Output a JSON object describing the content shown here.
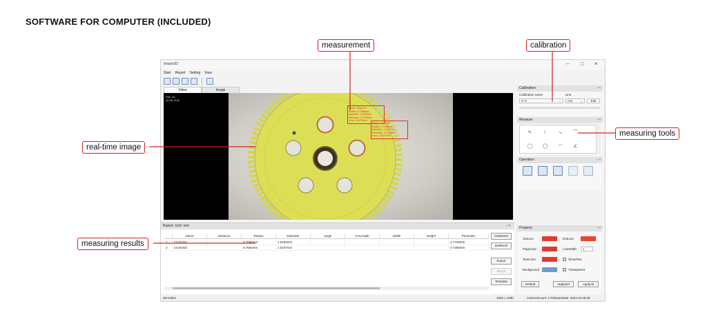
{
  "heading": "SOFTWARE FOR COMPUTER (INCLUDED)",
  "app": {
    "title": "Imsize2D",
    "window_controls": [
      "–",
      "□",
      "×"
    ],
    "menu": [
      "Start",
      "Report",
      "Setting",
      "View"
    ],
    "view_tabs": [
      "Video",
      "Image"
    ],
    "video_overlay": [
      "Fps: 14",
      "10:35, 6:41"
    ],
    "measurement_labels": [
      [
        "Name: Circle201",
        "Radius: 0.7596mm",
        "Diameter: 1.5192mm",
        "Perimeter: 4.7728mm",
        "Area: 1.8127mm²"
      ],
      [
        "Name: Circle202",
        "Radius: 0.7554mm",
        "Diameter: 1.5107mm",
        "Perimeter: 4.7460mm",
        "Area: 1.7927mm²"
      ]
    ]
  },
  "calibration": {
    "title": "Calibration",
    "name_label": "Calibration name",
    "unit_label": "Unit",
    "name_value": "0.7x",
    "unit_value": "mm",
    "edit_label": "Edit"
  },
  "measure_panel": {
    "title": "Measure"
  },
  "operation_panel": {
    "title": "Operation"
  },
  "report": {
    "title": "Report",
    "unit": "Unit: mm",
    "columns": [
      "",
      "Name",
      "Distance",
      "Radius",
      "Diameter",
      "Angle",
      "ArcLength",
      "Width",
      "Height",
      "Perimeter"
    ],
    "rows": [
      [
        "1",
        "Circle201",
        "",
        "0.7596mm",
        "1.5192mm",
        "",
        "",
        "",
        "",
        "4.7728mm"
      ],
      [
        "2",
        "Circle202",
        "",
        "0.7554mm",
        "1.5107mm",
        "",
        "",
        "",
        "",
        "4.7460mm"
      ]
    ],
    "buttons": [
      "DeleteSel",
      "DeleteAll",
      "Export",
      "Merge",
      "Template"
    ]
  },
  "property": {
    "title": "Property",
    "sol_line": "SolLine:",
    "dot_line": "DotLine:",
    "flag_color": "FlagColor:",
    "line_width": "LineWidth",
    "line_width_value": "1",
    "text_color": "TextColor:",
    "show_text": "ShowText",
    "background": "Background",
    "transparent": "Transparent",
    "buttons": [
      "Default",
      "ApplySel",
      "ApplyAll"
    ]
  },
  "statusbar": {
    "left": "WinVideo",
    "resolution": "1920 x 1080",
    "info": "CameraCount: 1  ReleaseDate: 2023.10.25.28"
  },
  "callouts": {
    "measurement": "measurement",
    "calibration": "calibration",
    "realtime": "real-time image",
    "tools": "measuring tools",
    "results": "measuring results"
  },
  "colors": {
    "gear": "#d9dc4e",
    "callout_border": "#d81e1e",
    "sol_line": "#e03a2b",
    "dot_line": "#e8472e",
    "flag_color": "#e03a2b",
    "text_color": "#e03a2b",
    "background": "#6d9bd4"
  }
}
